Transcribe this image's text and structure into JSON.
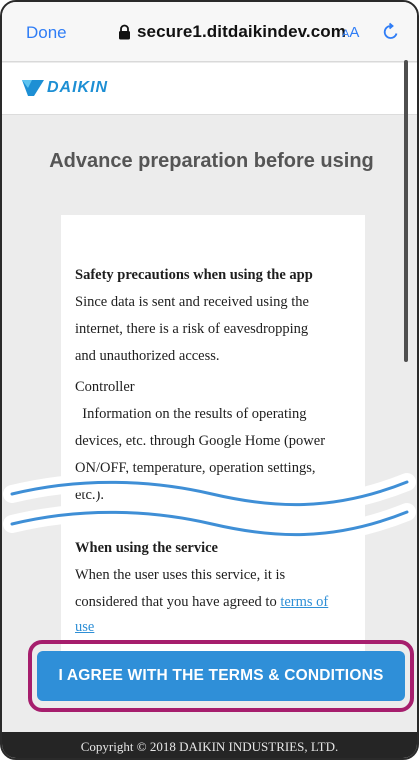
{
  "browser": {
    "done_label": "Done",
    "url": "secure1.ditdaikindev.com",
    "aa_label_small": "A",
    "aa_label_large": "A"
  },
  "brand": {
    "logo_text": "DAIKIN"
  },
  "page": {
    "title": "Advance preparation before using"
  },
  "content": {
    "safety_heading": "Safety precautions when using the app",
    "safety_lines": [
      "Since data is sent and received using the",
      "internet, there is a risk of eavesdropping",
      "and unauthorized access."
    ],
    "controller_label": "Controller",
    "controller_lines": [
      "  Information on the results of operating",
      "devices, etc. through Google Home (power",
      "ON/OFF, temperature, operation settings,",
      "etc.)."
    ],
    "service_heading": "When using the service",
    "service_lines": [
      "When the user uses this service, it is",
      "considered that you have agreed to "
    ],
    "terms_link_line1": "terms of",
    "terms_link_line2": "use"
  },
  "actions": {
    "agree_label": "I AGREE WITH THE TERMS & CONDITIONS"
  },
  "footer": {
    "copyright": "Copyright © 2018 DAIKIN INDUSTRIES, LTD."
  },
  "colors": {
    "accent": "#2f8fd8",
    "highlight": "#a61e6d",
    "brand": "#1d8fd4",
    "link": "#2e8fd6"
  }
}
